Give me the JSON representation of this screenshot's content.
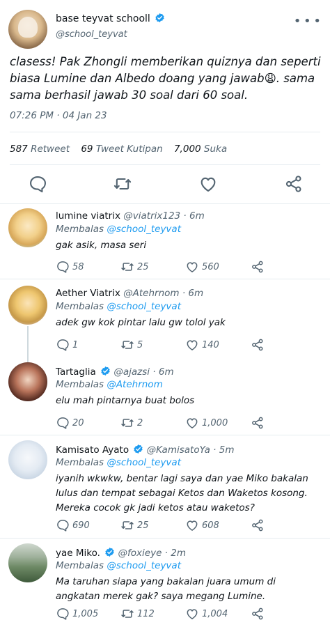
{
  "main_tweet": {
    "display_name": "base teyvat schooll",
    "handle": "@school_teyvat",
    "text": "clasess! Pak Zhongli memberikan quiznya dan seperti biasa Lumine dan Albedo doang yang jawab",
    "emoji": "😩",
    "text_end": ". sama sama berhasil jawab 30 soal dari 60 soal.",
    "timestamp": "07:26 PM · 04 Jan 23",
    "stats": {
      "retweets_count": "587",
      "retweets_label": "Retweet",
      "quotes_count": "69",
      "quotes_label": "Tweet Kutipan",
      "likes_count": "7,000",
      "likes_label": "Suka"
    }
  },
  "replies": [
    {
      "display_name": "lumine viatrix",
      "handle": "@viatrix123 · 6m",
      "reply_prefix": "Membalas",
      "reply_to": "@school_teyvat",
      "text": "gak asik, masa seri",
      "reply_count": "58",
      "retweet_count": "25",
      "like_count": "560"
    },
    {
      "display_name": "Aether Viatrix",
      "handle": "@Atehrnom · 6m",
      "reply_prefix": "Membalas",
      "reply_to": "@school_teyvat",
      "text": "adek gw kok pintar lalu gw tolol yak",
      "reply_count": "1",
      "retweet_count": "5",
      "like_count": "140"
    },
    {
      "display_name": "Tartaglia",
      "handle": "@ajazsi · 6m",
      "reply_prefix": "Membalas",
      "reply_to": "@Atehrnom",
      "text": "elu mah pintarnya buat bolos",
      "reply_count": "20",
      "retweet_count": "2",
      "like_count": "1,000"
    },
    {
      "display_name": "Kamisato Ayato",
      "handle": "@KamisatoYa · 5m",
      "reply_prefix": "Membalas",
      "reply_to": "@school_teyvat",
      "text": "iyanih wkwkw, bentar lagi saya dan yae Miko bakalan lulus dan tempat sebagai Ketos dan Waketos kosong. Mereka cocok gk jadi ketos atau waketos?",
      "reply_count": "690",
      "retweet_count": "25",
      "like_count": "608"
    },
    {
      "display_name": "yae Miko.",
      "handle": "@foxieye · 2m",
      "reply_prefix": "Membalas",
      "reply_to": "@school_teyvat",
      "text": "Ma taruhan siapa yang bakalan juara umum di angkatan merek gak? saya megang Lumine.",
      "reply_count": "1,005",
      "retweet_count": "112",
      "like_count": "1,004"
    }
  ],
  "colors": {
    "accent": "#1d9bf0",
    "muted": "#536471",
    "divider": "#e6ecf0"
  }
}
